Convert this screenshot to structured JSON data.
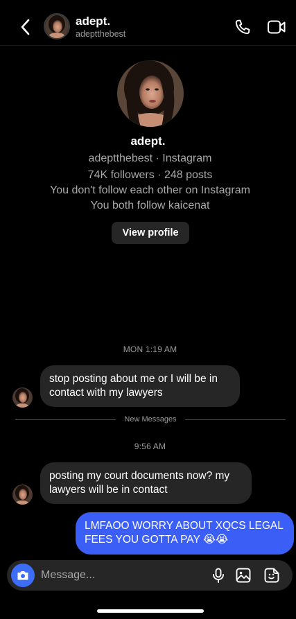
{
  "header": {
    "name": "adept.",
    "handle": "adeptthebest",
    "back_icon": "chevron-left-icon",
    "call_icon": "phone-icon",
    "video_icon": "video-camera-icon"
  },
  "profile": {
    "name": "adept.",
    "source": "adeptthebest · Instagram",
    "stats": "74K followers · 248 posts",
    "follow_status": "You don't follow each other on Instagram",
    "mutual": "You both follow kaicenat",
    "view_profile_label": "View profile"
  },
  "messages": {
    "time_1": "MON 1:19 AM",
    "msg_1": "stop posting about me or I will be in contact with my lawyers",
    "divider_label": "New Messages",
    "time_2": "9:56 AM",
    "msg_2": "posting my court documents now? my lawyers will be in contact",
    "msg_3": "LMFAOO WORRY ABOUT XQCS LEGAL FEES YOU GOTTA PAY 😭😭"
  },
  "composer": {
    "placeholder": "Message...",
    "camera_icon": "camera-icon",
    "mic_icon": "microphone-icon",
    "gallery_icon": "image-icon",
    "sticker_icon": "sticker-icon"
  },
  "colors": {
    "background": "#000000",
    "incoming_bubble": "#262626",
    "outgoing_bubble": "#3b5ef6",
    "camera_button": "#3d6cf6",
    "secondary_text": "#a8a8a8"
  }
}
